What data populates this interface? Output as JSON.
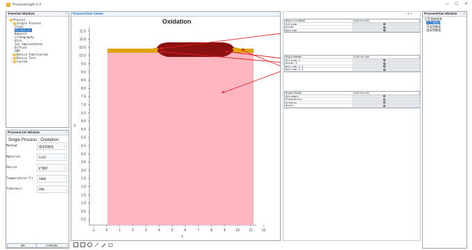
{
  "app": {
    "title": "ProcessInsight 0.3"
  },
  "window_controls": {
    "minimize": "—",
    "maximize": "☐",
    "close": "✕"
  },
  "tree_window": {
    "title": "TreeView Window",
    "items": [
      {
        "label": "Process",
        "level": 0,
        "expander": "−"
      },
      {
        "label": "Single Process",
        "level": 1,
        "expander": "−"
      },
      {
        "label": "Clean",
        "level": 2
      },
      {
        "label": "Oxidation",
        "level": 2,
        "selected": true
      },
      {
        "label": "Deposit",
        "level": 2
      },
      {
        "label": "Lithography",
        "level": 2
      },
      {
        "label": "Etch",
        "level": 2
      },
      {
        "label": "Ion Implantation",
        "level": 2
      },
      {
        "label": "Diffuse",
        "level": 2
      },
      {
        "label": "CMP",
        "level": 2
      },
      {
        "label": "Device Fabrication",
        "level": 1,
        "expander": "+"
      },
      {
        "label": "Device Test",
        "level": 1,
        "expander": "+"
      },
      {
        "label": "Custom",
        "level": 1,
        "expander": "+"
      }
    ]
  },
  "process_window": {
    "title": "ProcessLCD Window",
    "subtitle": "Single Process : Oxidation",
    "fields": [
      {
        "key": "Method",
        "value": "湿法热氧化",
        "dropdown": true
      },
      {
        "key": "Material",
        "value": "SiO2",
        "dropdown": true
      },
      {
        "key": "Device",
        "value": "扩散炉",
        "dropdown": true
      },
      {
        "key": "Temperature(°C)",
        "value": "1000",
        "dropdown": false
      },
      {
        "key": "Time(min)",
        "value": "200",
        "dropdown": false
      }
    ],
    "ok_label": "OK",
    "cancel_label": "CANCEL"
  },
  "viewer": {
    "tab_label": "ProcessView Viewer",
    "plot_title": "Oxidation",
    "xlabel": "x",
    "ylabel": "y",
    "x_ticks": [
      "-1",
      "0",
      "1",
      "2",
      "3",
      "4",
      "5",
      "6",
      "7",
      "8",
      "9",
      "10",
      "11",
      "12"
    ],
    "y_ticks": [
      "0.0",
      "0.5",
      "1.0",
      "1.5",
      "2.0",
      "2.5",
      "3.0",
      "3.5",
      "4.0",
      "4.5",
      "5.0",
      "5.5",
      "6.0",
      "6.5",
      "7.0",
      "7.5",
      "8.0",
      "8.5",
      "9.0",
      "9.5",
      "10.0",
      "10.5",
      "11.0",
      "11.5"
    ],
    "colors": {
      "substrate": "#ffb6c1",
      "oxide": "#e0a312",
      "locos": "#8b1010",
      "arrow": "#e02020"
    }
  },
  "material_table": {
    "col1": "MaterialName",
    "col2": "isSelected",
    "rows": [
      {
        "name": "Silicon",
        "checked": true
      },
      {
        "name": "Oxide",
        "checked": true
      },
      {
        "name": "Nitride",
        "checked": true
      }
    ]
  },
  "region_table": {
    "col1": "RegionName",
    "col2": "isSelected",
    "rows": [
      {
        "name": "Silicon_1",
        "checked": true
      },
      {
        "name": "Oxide_1",
        "checked": true
      },
      {
        "name": "Nitride_1_1",
        "checked": true
      },
      {
        "name": "Nitride_1_2",
        "checked": true
      }
    ]
  },
  "dopant_table": {
    "col1": "DopantName",
    "col2": "isSelected",
    "rows": [
      {
        "name": "Antimony",
        "checked": false
      },
      {
        "name": "Phosphorus",
        "checked": false
      },
      {
        "name": "Arsenic",
        "checked": false
      },
      {
        "name": "Boron",
        "checked": false
      }
    ]
  },
  "right_window": {
    "title": "ProcessFlow Window",
    "items": [
      {
        "label": "工艺流程组件",
        "selected": false
      },
      {
        "label": "工艺流程2",
        "selected": true
      },
      {
        "label": "干法热氧化",
        "selected": false
      },
      {
        "label": "湿法热氧化",
        "selected": false
      }
    ]
  }
}
